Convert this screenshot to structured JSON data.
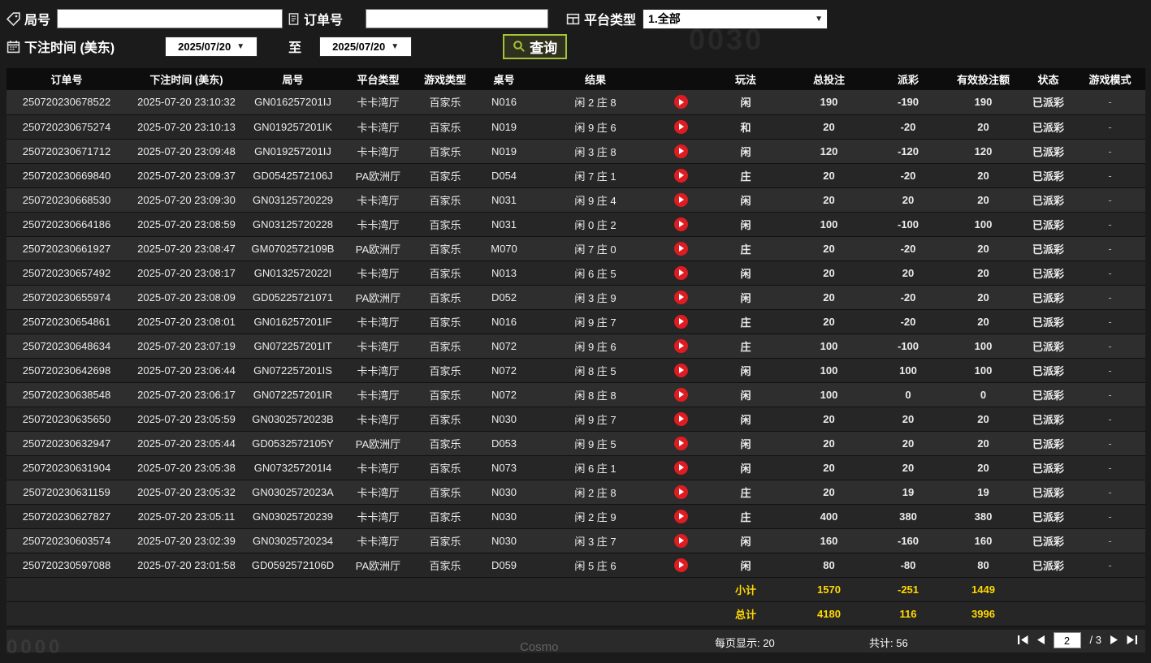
{
  "background": {
    "ghost_top_right": "0030",
    "ghost_bottom_left": "0000",
    "ghost_bottom_center": "Cosmo"
  },
  "filters": {
    "round_label": "局号",
    "order_label": "订单号",
    "platform_label": "平台类型",
    "platform_value": "1.全部",
    "bet_time_label": "下注时间 (美东)",
    "date_from": "2025/07/20",
    "to_label": "至",
    "date_to": "2025/07/20",
    "search_label": "查询"
  },
  "table": {
    "headers": [
      "订单号",
      "下注时间 (美东)",
      "局号",
      "平台类型",
      "游戏类型",
      "桌号",
      "结果",
      "",
      "玩法",
      "总投注",
      "派彩",
      "有效投注额",
      "状态",
      "游戏模式"
    ],
    "rows": [
      {
        "order": "250720230678522",
        "time": "2025-07-20 23:10:32",
        "round": "GN016257201IJ",
        "platform": "卡卡湾厅",
        "game": "百家乐",
        "table": "N016",
        "result": "闲 2 庄 8",
        "play": "闲",
        "bet": "190",
        "payout": "-190",
        "payout_tone": "green",
        "valid": "190",
        "status": "已派彩",
        "mode": "-"
      },
      {
        "order": "250720230675274",
        "time": "2025-07-20 23:10:13",
        "round": "GN019257201IK",
        "platform": "卡卡湾厅",
        "game": "百家乐",
        "table": "N019",
        "result": "闲 9 庄 6",
        "play": "和",
        "bet": "20",
        "payout": "-20",
        "payout_tone": "green",
        "valid": "20",
        "status": "已派彩",
        "mode": "-"
      },
      {
        "order": "250720230671712",
        "time": "2025-07-20 23:09:48",
        "round": "GN019257201IJ",
        "platform": "卡卡湾厅",
        "game": "百家乐",
        "table": "N019",
        "result": "闲 3 庄 8",
        "play": "闲",
        "bet": "120",
        "payout": "-120",
        "payout_tone": "green",
        "valid": "120",
        "status": "已派彩",
        "mode": "-"
      },
      {
        "order": "250720230669840",
        "time": "2025-07-20 23:09:37",
        "round": "GD0542572106J",
        "platform": "PA欧洲厅",
        "game": "百家乐",
        "table": "D054",
        "result": "闲 7 庄 1",
        "play": "庄",
        "bet": "20",
        "payout": "-20",
        "payout_tone": "green",
        "valid": "20",
        "status": "已派彩",
        "mode": "-"
      },
      {
        "order": "250720230668530",
        "time": "2025-07-20 23:09:30",
        "round": "GN03125720229",
        "platform": "卡卡湾厅",
        "game": "百家乐",
        "table": "N031",
        "result": "闲 9 庄 4",
        "play": "闲",
        "bet": "20",
        "payout": "20",
        "payout_tone": "red",
        "valid": "20",
        "status": "已派彩",
        "mode": "-"
      },
      {
        "order": "250720230664186",
        "time": "2025-07-20 23:08:59",
        "round": "GN03125720228",
        "platform": "卡卡湾厅",
        "game": "百家乐",
        "table": "N031",
        "result": "闲 0 庄 2",
        "play": "闲",
        "bet": "100",
        "payout": "-100",
        "payout_tone": "green",
        "valid": "100",
        "status": "已派彩",
        "mode": "-"
      },
      {
        "order": "250720230661927",
        "time": "2025-07-20 23:08:47",
        "round": "GM0702572109B",
        "platform": "PA欧洲厅",
        "game": "百家乐",
        "table": "M070",
        "result": "闲 7 庄 0",
        "play": "庄",
        "bet": "20",
        "payout": "-20",
        "payout_tone": "green",
        "valid": "20",
        "status": "已派彩",
        "mode": "-"
      },
      {
        "order": "250720230657492",
        "time": "2025-07-20 23:08:17",
        "round": "GN0132572022I",
        "platform": "卡卡湾厅",
        "game": "百家乐",
        "table": "N013",
        "result": "闲 6 庄 5",
        "play": "闲",
        "bet": "20",
        "payout": "20",
        "payout_tone": "red",
        "valid": "20",
        "status": "已派彩",
        "mode": "-"
      },
      {
        "order": "250720230655974",
        "time": "2025-07-20 23:08:09",
        "round": "GD05225721071",
        "platform": "PA欧洲厅",
        "game": "百家乐",
        "table": "D052",
        "result": "闲 3 庄 9",
        "play": "闲",
        "bet": "20",
        "payout": "-20",
        "payout_tone": "green",
        "valid": "20",
        "status": "已派彩",
        "mode": "-"
      },
      {
        "order": "250720230654861",
        "time": "2025-07-20 23:08:01",
        "round": "GN016257201IF",
        "platform": "卡卡湾厅",
        "game": "百家乐",
        "table": "N016",
        "result": "闲 9 庄 7",
        "play": "庄",
        "bet": "20",
        "payout": "-20",
        "payout_tone": "green",
        "valid": "20",
        "status": "已派彩",
        "mode": "-"
      },
      {
        "order": "250720230648634",
        "time": "2025-07-20 23:07:19",
        "round": "GN072257201IT",
        "platform": "卡卡湾厅",
        "game": "百家乐",
        "table": "N072",
        "result": "闲 9 庄 6",
        "play": "庄",
        "bet": "100",
        "payout": "-100",
        "payout_tone": "green",
        "valid": "100",
        "status": "已派彩",
        "mode": "-"
      },
      {
        "order": "250720230642698",
        "time": "2025-07-20 23:06:44",
        "round": "GN072257201IS",
        "platform": "卡卡湾厅",
        "game": "百家乐",
        "table": "N072",
        "result": "闲 8 庄 5",
        "play": "闲",
        "bet": "100",
        "payout": "100",
        "payout_tone": "red",
        "valid": "100",
        "status": "已派彩",
        "mode": "-"
      },
      {
        "order": "250720230638548",
        "time": "2025-07-20 23:06:17",
        "round": "GN072257201IR",
        "platform": "卡卡湾厅",
        "game": "百家乐",
        "table": "N072",
        "result": "闲 8 庄 8",
        "play": "闲",
        "bet": "100",
        "payout": "0",
        "payout_tone": "white",
        "valid": "0",
        "status": "已派彩",
        "mode": "-"
      },
      {
        "order": "250720230635650",
        "time": "2025-07-20 23:05:59",
        "round": "GN0302572023B",
        "platform": "卡卡湾厅",
        "game": "百家乐",
        "table": "N030",
        "result": "闲 9 庄 7",
        "play": "闲",
        "bet": "20",
        "payout": "20",
        "payout_tone": "red",
        "valid": "20",
        "status": "已派彩",
        "mode": "-"
      },
      {
        "order": "250720230632947",
        "time": "2025-07-20 23:05:44",
        "round": "GD0532572105Y",
        "platform": "PA欧洲厅",
        "game": "百家乐",
        "table": "D053",
        "result": "闲 9 庄 5",
        "play": "闲",
        "bet": "20",
        "payout": "20",
        "payout_tone": "red",
        "valid": "20",
        "status": "已派彩",
        "mode": "-"
      },
      {
        "order": "250720230631904",
        "time": "2025-07-20 23:05:38",
        "round": "GN073257201I4",
        "platform": "卡卡湾厅",
        "game": "百家乐",
        "table": "N073",
        "result": "闲 6 庄 1",
        "play": "闲",
        "bet": "20",
        "payout": "20",
        "payout_tone": "red",
        "valid": "20",
        "status": "已派彩",
        "mode": "-"
      },
      {
        "order": "250720230631159",
        "time": "2025-07-20 23:05:32",
        "round": "GN0302572023A",
        "platform": "卡卡湾厅",
        "game": "百家乐",
        "table": "N030",
        "result": "闲 2 庄 8",
        "play": "庄",
        "bet": "20",
        "payout": "19",
        "payout_tone": "red",
        "valid": "19",
        "status": "已派彩",
        "mode": "-"
      },
      {
        "order": "250720230627827",
        "time": "2025-07-20 23:05:11",
        "round": "GN03025720239",
        "platform": "卡卡湾厅",
        "game": "百家乐",
        "table": "N030",
        "result": "闲 2 庄 9",
        "play": "庄",
        "bet": "400",
        "payout": "380",
        "payout_tone": "red",
        "valid": "380",
        "status": "已派彩",
        "mode": "-"
      },
      {
        "order": "250720230603574",
        "time": "2025-07-20 23:02:39",
        "round": "GN03025720234",
        "platform": "卡卡湾厅",
        "game": "百家乐",
        "table": "N030",
        "result": "闲 3 庄 7",
        "play": "闲",
        "bet": "160",
        "payout": "-160",
        "payout_tone": "green",
        "valid": "160",
        "status": "已派彩",
        "mode": "-"
      },
      {
        "order": "250720230597088",
        "time": "2025-07-20 23:01:58",
        "round": "GD0592572106D",
        "platform": "PA欧洲厅",
        "game": "百家乐",
        "table": "D059",
        "result": "闲 5 庄 6",
        "play": "闲",
        "bet": "80",
        "payout": "-80",
        "payout_tone": "green",
        "valid": "80",
        "status": "已派彩",
        "mode": "-"
      }
    ],
    "subtotal": {
      "label": "小计",
      "total_bet": "1570",
      "payout": "-251",
      "valid_bet": "1449"
    },
    "total": {
      "label": "总计",
      "total_bet": "4180",
      "payout": "116",
      "valid_bet": "3996"
    }
  },
  "pagination": {
    "per_page": "每页显示: 20",
    "total_count": "共计: 56",
    "current_page": "2",
    "separator": "/",
    "total_pages": "3"
  },
  "colors": {
    "payout_negative": "#44cc11",
    "payout_positive": "#b22626",
    "status_paid": "#1fc11f",
    "summary_text": "#ffd800",
    "search_button_border": "#a2c43a",
    "play_button": "#de1c22"
  }
}
